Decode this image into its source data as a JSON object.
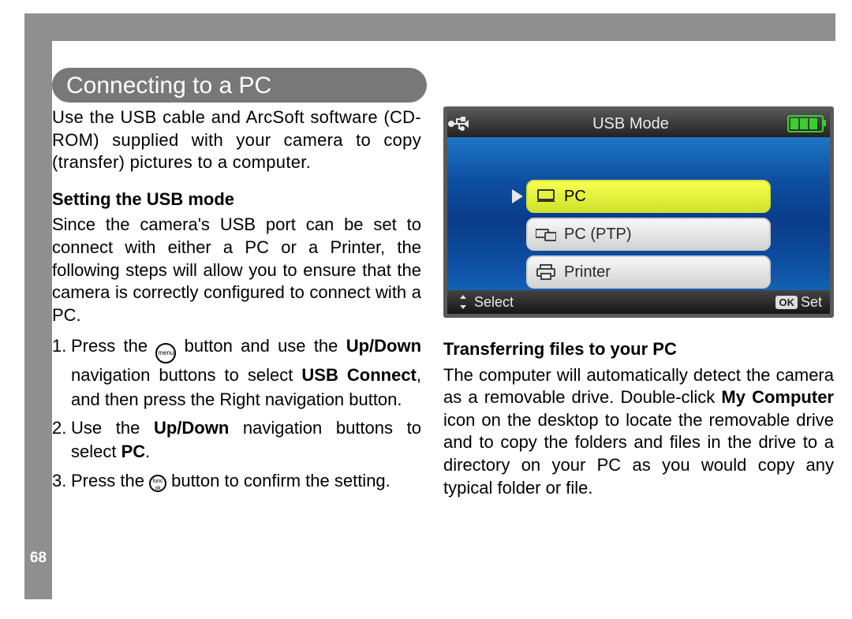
{
  "page_number": "68",
  "title": "Connecting to a PC",
  "left": {
    "intro": "Use the USB cable and ArcSoft software (CD-ROM) supplied with your camera to copy (transfer) pictures to a computer.",
    "section1_head": "Setting the USB mode",
    "section1_body": "Since the camera's USB port can be set to connect with either a PC or a Printer, the following steps will allow you to ensure that the camera is correctly configured to connect with a PC.",
    "step1_a": "Press the ",
    "step1_b": " button and use the ",
    "step1_updown": "Up/Down",
    "step1_c": " navigation buttons to select ",
    "step1_usbconnect": "USB Connect",
    "step1_d": ", and then press the Right navigation button.",
    "step2_a": "Use the ",
    "step2_updown": "Up/Down",
    "step2_b": " navigation buttons to select ",
    "step2_pc": "PC",
    "step2_c": ".",
    "step3_a": "Press the ",
    "step3_b": " button to confirm the setting.",
    "menu_label": "menu",
    "func_label_top": "func",
    "func_label_bot": "ok"
  },
  "screen": {
    "title": "USB Mode",
    "items": [
      "PC",
      "PC (PTP)",
      "Printer"
    ],
    "select_label": "Select",
    "ok_badge": "OK",
    "set_label": "Set"
  },
  "right": {
    "section_head": "Transferring files to your PC",
    "body_a": "The computer will automatically detect the camera as a removable drive. Double-click ",
    "body_bold": "My Computer",
    "body_b": " icon on the desktop to locate the removable drive and to copy the folders and files in the drive to a directory on your PC as you would copy any typical folder or file."
  }
}
